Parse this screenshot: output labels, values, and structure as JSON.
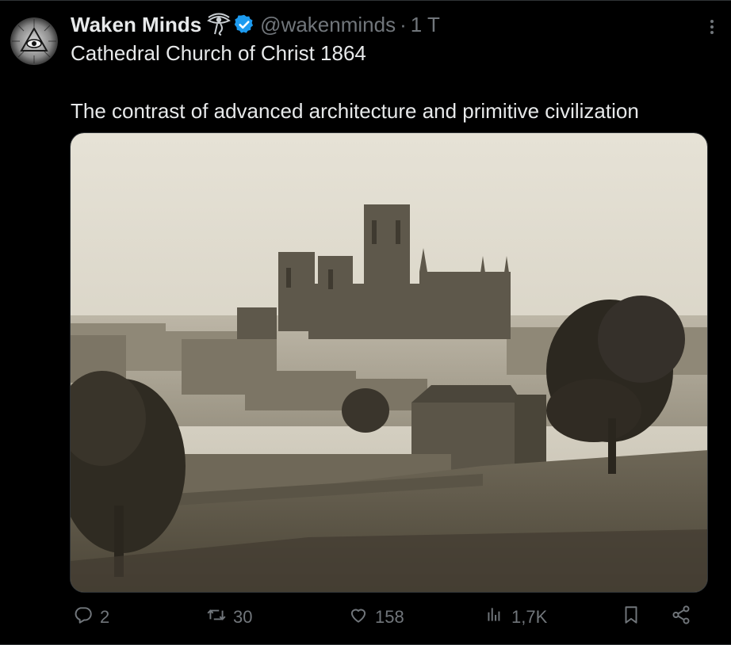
{
  "tweet": {
    "display_name": "Waken Minds",
    "handle": "@wakenminds",
    "separator": "·",
    "timestamp": "1 T",
    "text_line1": "Cathedral Church of Christ 1864",
    "text_line2": "The contrast of advanced architecture and primitive civilization"
  },
  "actions": {
    "reply_count": "2",
    "repost_count": "30",
    "like_count": "158",
    "views_count": "1,7K"
  },
  "icons": {
    "avatar": "all-seeing-eye-avatar",
    "name_emoji": "eye-of-horus-icon",
    "verified": "verified-badge-icon",
    "more": "more-options-icon",
    "reply": "reply-icon",
    "repost": "repost-icon",
    "like": "heart-icon",
    "views": "views-icon",
    "bookmark": "bookmark-icon",
    "share": "share-icon"
  },
  "colors": {
    "background": "#000000",
    "primary_text": "#e7e9ea",
    "secondary_text": "#71767b",
    "verified_blue": "#1d9bf0",
    "divider": "#2f3336"
  }
}
